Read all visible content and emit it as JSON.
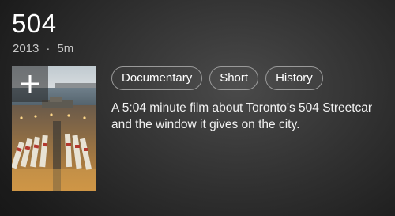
{
  "title": "504",
  "meta": {
    "year": "2013",
    "separator": "·",
    "duration": "5m"
  },
  "poster": {
    "icon": "add-icon"
  },
  "genres": [
    "Documentary",
    "Short",
    "History"
  ],
  "description": "A 5:04 minute film about Toronto's 504 Streetcar and the window it gives on the city."
}
